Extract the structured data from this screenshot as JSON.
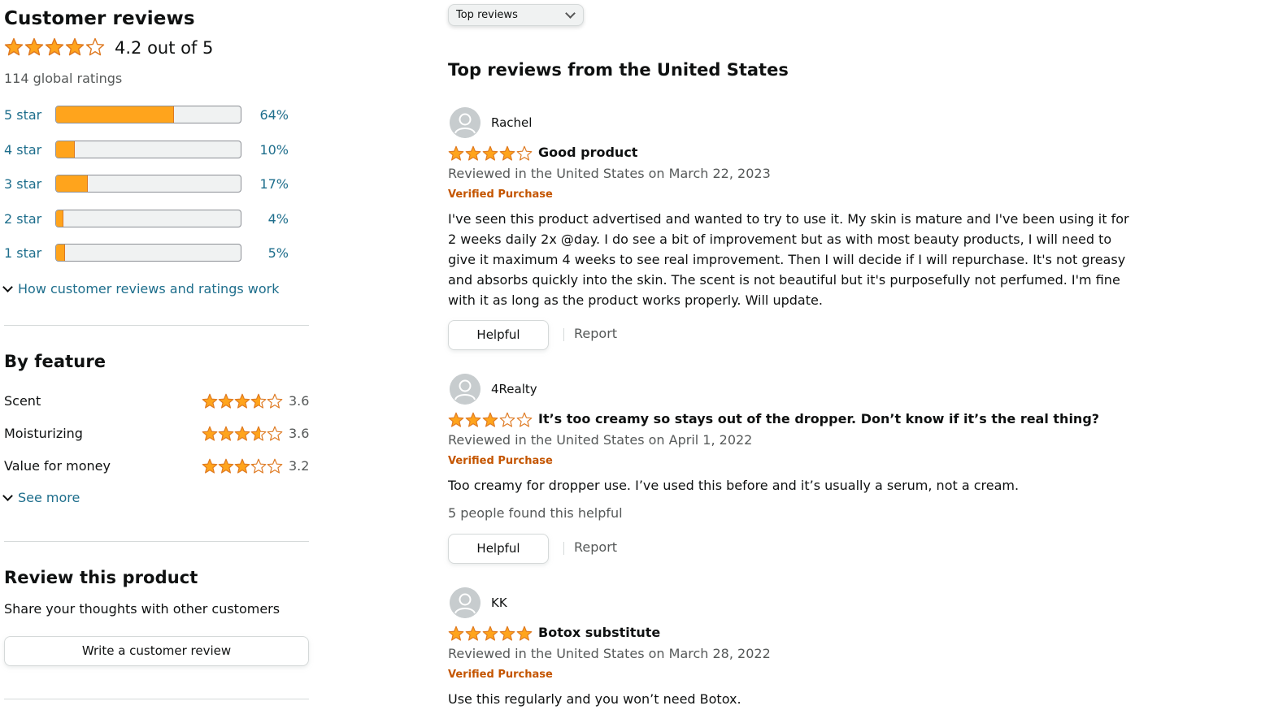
{
  "summary": {
    "title": "Customer reviews",
    "rating_value": 4.2,
    "rating_text": "4.2 out of 5",
    "global_ratings": "114 global ratings",
    "histogram": [
      {
        "label": "5 star",
        "percent": 64,
        "percent_text": "64%"
      },
      {
        "label": "4 star",
        "percent": 10,
        "percent_text": "10%"
      },
      {
        "label": "3 star",
        "percent": 17,
        "percent_text": "17%"
      },
      {
        "label": "2 star",
        "percent": 4,
        "percent_text": "4%"
      },
      {
        "label": "1 star",
        "percent": 5,
        "percent_text": "5%"
      }
    ],
    "how_link": "How customer reviews and ratings work"
  },
  "by_feature": {
    "title": "By feature",
    "features": [
      {
        "name": "Scent",
        "rating": 3.6,
        "rating_text": "3.6"
      },
      {
        "name": "Moisturizing",
        "rating": 3.6,
        "rating_text": "3.6"
      },
      {
        "name": "Value for money",
        "rating": 3.2,
        "rating_text": "3.2"
      }
    ],
    "see_more": "See more"
  },
  "review_product": {
    "title": "Review this product",
    "subtitle": "Share your thoughts with other customers",
    "button": "Write a customer review"
  },
  "sort": {
    "selected": "Top reviews"
  },
  "reviews_section": {
    "title": "Top reviews from the United States"
  },
  "reviews": [
    {
      "reviewer": "Rachel",
      "rating": 4,
      "title": "Good product",
      "date": "Reviewed in the United States on March 22, 2023",
      "verified": "Verified Purchase",
      "body": "I've seen this product advertised and wanted to try to use it. My skin is mature and I've been using it for 2 weeks daily 2x @day. I do see a bit of improvement but as with most beauty products, I will need to give it maximum 4 weeks to see real improvement. Then I will decide if I will repurchase. It's not greasy and absorbs quickly into the skin. The scent is not beautiful but it's purposefully not perfumed. I'm fine with it as long as the product works properly. Will update.",
      "helpful_count": "",
      "helpful_label": "Helpful",
      "report_label": "Report"
    },
    {
      "reviewer": "4Realty",
      "rating": 3,
      "title": "It’s too creamy so stays out of the dropper. Don’t know if it’s the real thing?",
      "date": "Reviewed in the United States on April 1, 2022",
      "verified": "Verified Purchase",
      "body": "Too creamy for dropper use. I’ve used this before and it’s usually a serum, not a cream.",
      "helpful_count": "5 people found this helpful",
      "helpful_label": "Helpful",
      "report_label": "Report"
    },
    {
      "reviewer": "KK",
      "rating": 5,
      "title": "Botox substitute",
      "date": "Reviewed in the United States on March 28, 2022",
      "verified": "Verified Purchase",
      "body": "Use this regularly and you won’t need Botox."
    }
  ],
  "colors": {
    "star": "#ffa41c",
    "star_outline": "#de7921",
    "link": "#1e6e8c",
    "verified": "#c45500"
  }
}
